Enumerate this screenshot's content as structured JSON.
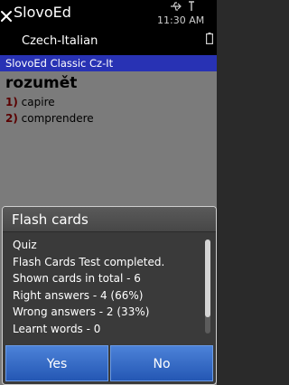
{
  "status_bar": {
    "app_title": "SlovoEd",
    "subtitle": "Czech-Italian",
    "time": "11:30 AM",
    "close_icon": "close-icon",
    "usb_icon": "usb-icon",
    "signal_icon": "signal-icon",
    "battery_icon": "battery-icon"
  },
  "dictionary": {
    "name": "SlovoEd Classic Cz-It"
  },
  "entry": {
    "headword": "rozumět",
    "translations": [
      {
        "num": "1)",
        "text": "capire"
      },
      {
        "num": "2)",
        "text": "comprendere"
      }
    ]
  },
  "dialog": {
    "title": "Flash cards",
    "lines": [
      "Quiz",
      "Flash Cards Test completed.",
      "Shown cards in total - 6",
      "Right answers - 4 (66%)",
      "Wrong answers - 2 (33%)",
      "Learnt words - 0"
    ],
    "yes_label": "Yes",
    "no_label": "No"
  },
  "colors": {
    "dictionary_bar": "#2832b4",
    "softkey": "#2f66c4",
    "dialog_background": "#3a3a3a"
  }
}
